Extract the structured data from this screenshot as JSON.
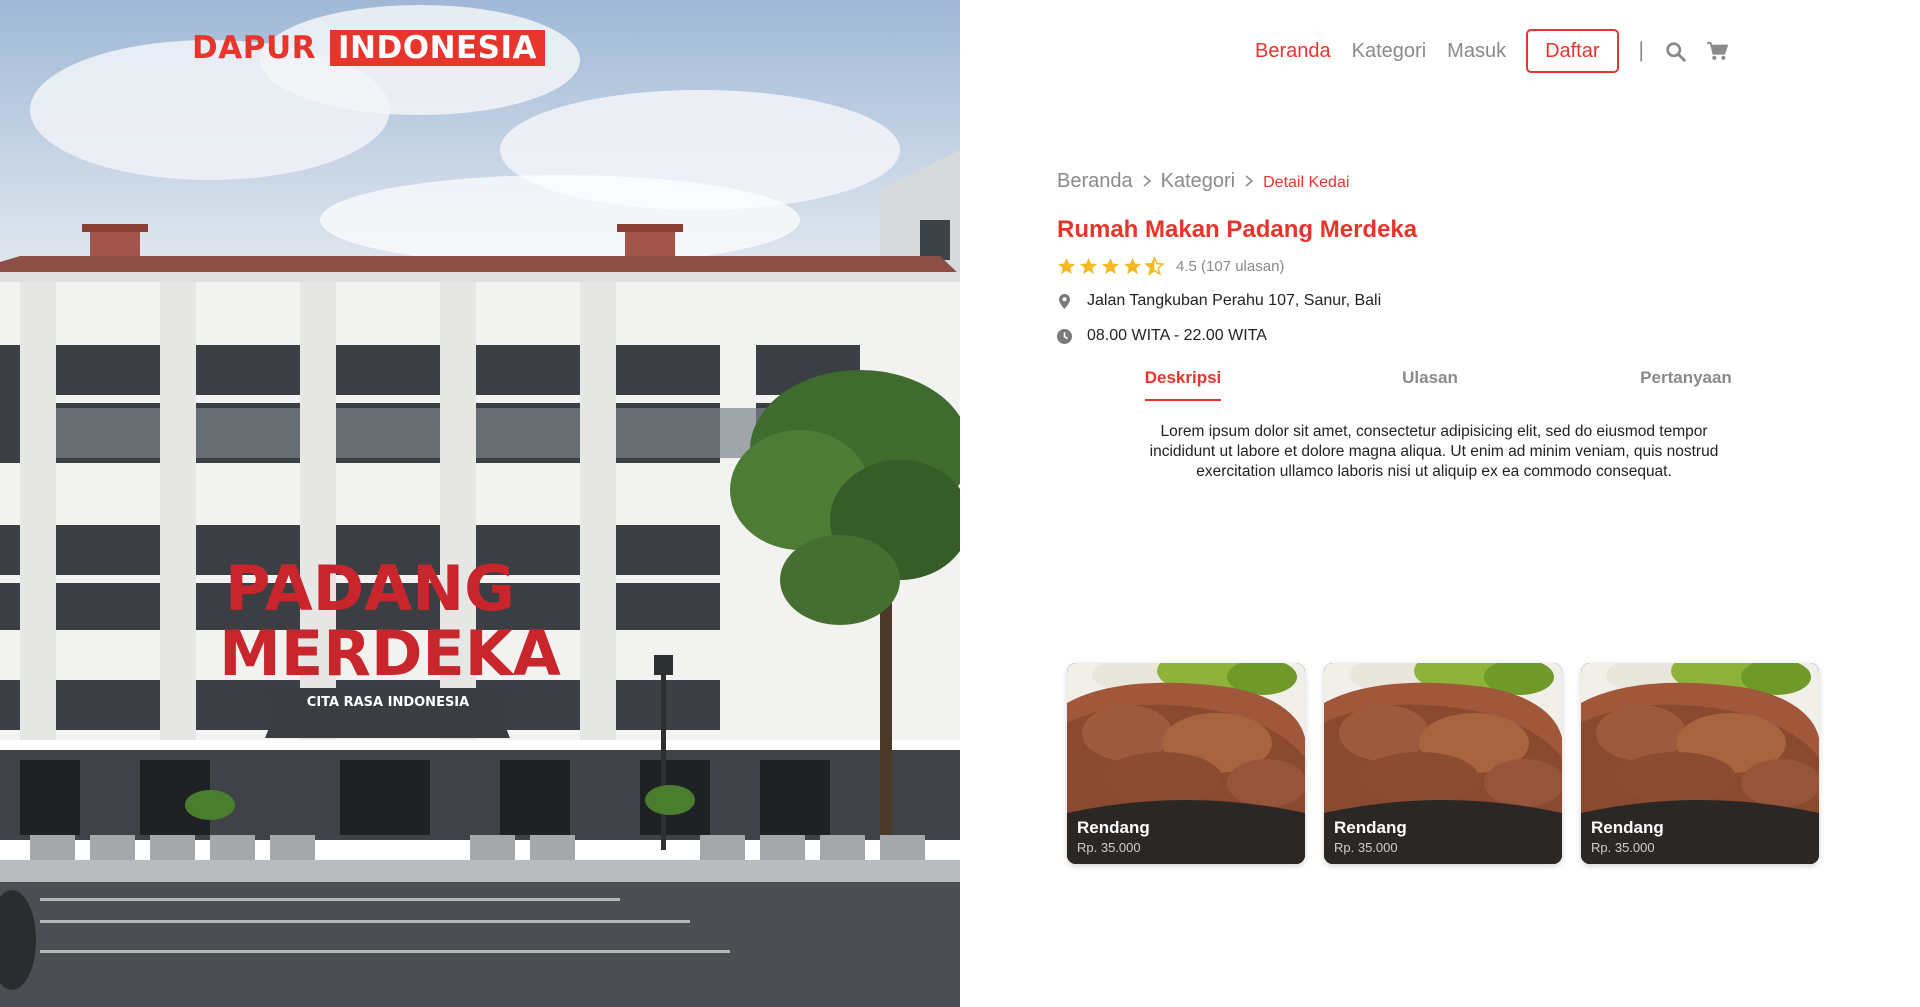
{
  "brand": {
    "part1": "DAPUR",
    "part2": "INDONESIA"
  },
  "hero": {
    "sign_line1": "PADANG",
    "sign_line2": "MERDEKA",
    "sign_banner": "CITA RASA INDONESIA"
  },
  "nav": {
    "links": [
      "Beranda",
      "Kategori",
      "Masuk"
    ],
    "register_label": "Daftar",
    "separator": "|",
    "icons": [
      "search-icon",
      "cart-icon"
    ]
  },
  "breadcrumb": [
    "Beranda",
    "Kategori",
    "Detail Kedai"
  ],
  "restaurant": {
    "name": "Rumah Makan Padang Merdeka",
    "rating_value": 4.5,
    "rating_text": "4.5 (107 ulasan)",
    "address": "Jalan Tangkuban Perahu 107, Sanur, Bali",
    "hours": "08.00 WITA - 22.00 WITA"
  },
  "tabs": [
    "Deskripsi",
    "Ulasan",
    "Pertanyaan"
  ],
  "active_tab": "Deskripsi",
  "description": "Lorem ipsum dolor sit amet, consectetur adipisicing elit, sed do eiusmod tempor incididunt ut labore et dolore magna aliqua. Ut enim ad minim veniam, quis nostrud exercitation ullamco laboris nisi ut aliquip ex ea commodo consequat.",
  "menu": [
    {
      "name": "Rendang",
      "price": "Rp. 35.000"
    },
    {
      "name": "Rendang",
      "price": "Rp. 35.000"
    },
    {
      "name": "Rendang",
      "price": "Rp. 35.000"
    }
  ],
  "colors": {
    "accent": "#e8352b",
    "muted": "#8a8a8a",
    "star": "#f5b921"
  }
}
